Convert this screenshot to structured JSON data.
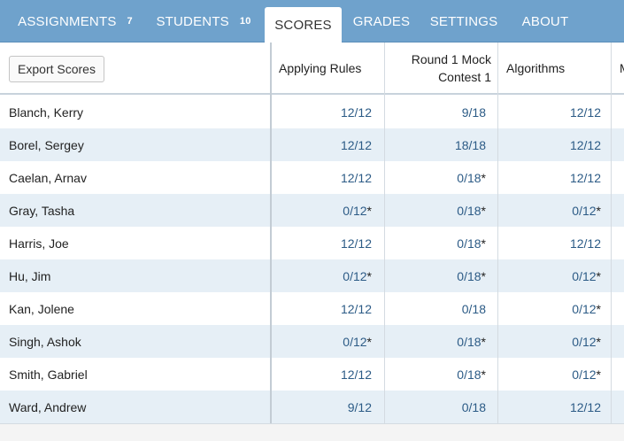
{
  "nav": {
    "tabs": [
      {
        "label": "ASSIGNMENTS",
        "count": "7"
      },
      {
        "label": "STUDENTS",
        "count": "10"
      },
      {
        "label": "SCORES",
        "count": ""
      },
      {
        "label": "GRADES",
        "count": ""
      },
      {
        "label": "SETTINGS",
        "count": ""
      },
      {
        "label": "ABOUT",
        "count": ""
      }
    ],
    "active_tab": "SCORES"
  },
  "toolbar": {
    "export_label": "Export Scores"
  },
  "columns": {
    "col1_label": "Applying Rules",
    "col2_label_line1": "Round 1 Mock",
    "col2_label_line2": "Contest 1",
    "col3_label": "Algorithms",
    "col4_label_partial": "M"
  },
  "rows": [
    {
      "name": "Blanch, Kerry",
      "s1": "12/12",
      "s1_star": "",
      "s2": "9/18",
      "s2_star": "",
      "s3": "12/12",
      "s3_star": ""
    },
    {
      "name": "Borel, Sergey",
      "s1": "12/12",
      "s1_star": "",
      "s2": "18/18",
      "s2_star": "",
      "s3": "12/12",
      "s3_star": ""
    },
    {
      "name": "Caelan, Arnav",
      "s1": "12/12",
      "s1_star": "",
      "s2": "0/18",
      "s2_star": "*",
      "s3": "12/12",
      "s3_star": ""
    },
    {
      "name": "Gray, Tasha",
      "s1": "0/12",
      "s1_star": "*",
      "s2": "0/18",
      "s2_star": "*",
      "s3": "0/12",
      "s3_star": "*"
    },
    {
      "name": "Harris, Joe",
      "s1": "12/12",
      "s1_star": "",
      "s2": "0/18",
      "s2_star": "*",
      "s3": "12/12",
      "s3_star": ""
    },
    {
      "name": "Hu, Jim",
      "s1": "0/12",
      "s1_star": "*",
      "s2": "0/18",
      "s2_star": "*",
      "s3": "0/12",
      "s3_star": "*"
    },
    {
      "name": "Kan, Jolene",
      "s1": "12/12",
      "s1_star": "",
      "s2": "0/18",
      "s2_star": "",
      "s3": "0/12",
      "s3_star": "*"
    },
    {
      "name": "Singh, Ashok",
      "s1": "0/12",
      "s1_star": "*",
      "s2": "0/18",
      "s2_star": "*",
      "s3": "0/12",
      "s3_star": "*"
    },
    {
      "name": "Smith, Gabriel",
      "s1": "12/12",
      "s1_star": "",
      "s2": "0/18",
      "s2_star": "*",
      "s3": "0/12",
      "s3_star": "*"
    },
    {
      "name": "Ward, Andrew",
      "s1": "9/12",
      "s1_star": "",
      "s2": "0/18",
      "s2_star": "",
      "s3": "12/12",
      "s3_star": ""
    }
  ],
  "colors": {
    "nav_bg": "#6fa2cc",
    "score_text": "#2c5b86",
    "row_alt": "#e6eff6"
  }
}
